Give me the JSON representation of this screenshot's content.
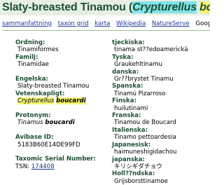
{
  "title": {
    "common": "Slaty-breasted Tinamou",
    "open_paren": "(",
    "genus": "Crypturellus",
    "species": "boucardi",
    "close_paren": ")"
  },
  "nav": {
    "links": [
      "sammanfattning",
      "taxon grid",
      "karta",
      "Wikipedia",
      "NatureServe"
    ],
    "google_label": "Google: W"
  },
  "left": {
    "ordning_label": "Ordning:",
    "ordning_value": "Tinamiformes",
    "familj_label": "Familj:",
    "familj_value": "Tinamidae",
    "engelska_label": "Engelska:",
    "engelska_value": "Slaty-breasted Tinamou",
    "vetenskapligt_label": "Vetenskapligt:",
    "vetenskapligt_genus": "Crypturellus",
    "vetenskapligt_species": "boucardi",
    "protonym_label": "Protonym:",
    "protonym_genus": "Tinamus",
    "protonym_species": "boucardi",
    "avibase_label": "Avibase ID:",
    "avibase_value": "5183B60E14DE99FD",
    "tsn_label": "Taxomic Serial Number:",
    "tsn_prefix": "TSN:",
    "tsn_value": "174408"
  },
  "right": {
    "entries": [
      {
        "label": "tjeckiska:",
        "value": "tinama st??edoamerická"
      },
      {
        "label": "Tyska:",
        "value": "Graukehltinamu"
      },
      {
        "label": "danska:",
        "value": "Gr??brystet Tinamu"
      },
      {
        "label": "Spanska:",
        "value": "Tinamú Pizarroso"
      },
      {
        "label": "Finska:",
        "value": "huilutinami"
      },
      {
        "label": "Franska:",
        "value": "Tinamou de Boucard"
      },
      {
        "label": "Italienska:",
        "value": "Tinamo pettoardesia"
      },
      {
        "label": "Japanesisk:",
        "value": "haimuneshigidachou"
      },
      {
        "label": "japanska:",
        "value": "キリシギダチョウ"
      },
      {
        "label": "Holl??ndska:",
        "value": "Grijsborsttinamoe"
      }
    ]
  }
}
